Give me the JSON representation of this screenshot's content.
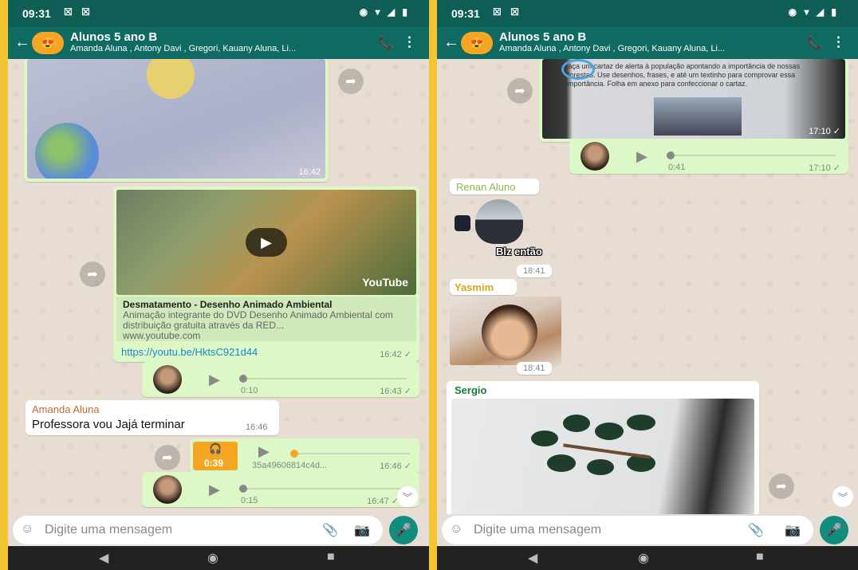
{
  "status": {
    "time": "09:31",
    "left_icons": "☒ ☒",
    "right_icons": "◉ ▾ ◢ ▮"
  },
  "chat": {
    "title": "Alunos 5 ano B",
    "subtitle": "Amanda Aluna , Antony Davi , Gregori, Kauany Aluna, Li..."
  },
  "left": {
    "img1_time": "16:42",
    "yt": {
      "brand": "YouTube",
      "title": "Desmatamento - Desenho Animado Ambiental",
      "desc": "Animação integrante do DVD Desenho Animado Ambiental com distribuição gratuita através da RED...",
      "domain": "www.youtube.com",
      "link": "https://youtu.be/HktsC921d44",
      "time": "16:42 ✓"
    },
    "audio1": {
      "duration": "0:10",
      "time": "16:43 ✓"
    },
    "incoming": {
      "sender": "Amanda Aluna",
      "text": "Professora vou Jajá terminar",
      "time": "16:46"
    },
    "file_audio": {
      "badge": "0:39",
      "name": "35a49606814c4d...",
      "time": "16:46 ✓"
    },
    "audio2": {
      "duration": "0:15",
      "time": "16:47 ✓"
    }
  },
  "right": {
    "img_time": "17:10 ✓",
    "doc_text": "faça um cartaz de alerta à população apontando a importância de nossas florestas. Use desenhos, frases, e até um textinho para comprovar essa importância. Folha em anexo para confeccionar o cartaz.",
    "audio": {
      "duration": "0:41",
      "time": "17:10 ✓"
    },
    "renan": {
      "sender": "Renan Aluno",
      "sticker_text": "Blz então",
      "time": "18:41"
    },
    "yasmim": {
      "sender": "Yasmim",
      "time": "18:41"
    },
    "sergio": {
      "sender": "Sergio"
    }
  },
  "input": {
    "placeholder": "Digite uma mensagem"
  },
  "colors": {
    "header": "#0f6b61",
    "status": "#0f5e55",
    "outgoing": "#dcf8c6",
    "accent": "#128c7e",
    "frame": "#f4c433"
  },
  "icons": [
    "back-arrow-icon",
    "add-call-icon",
    "more-menu-icon",
    "forward-icon",
    "play-icon",
    "mic-icon",
    "emoji-icon",
    "attach-icon",
    "camera-icon",
    "headphones-icon",
    "nav-back-icon",
    "nav-home-icon",
    "nav-recents-icon"
  ]
}
